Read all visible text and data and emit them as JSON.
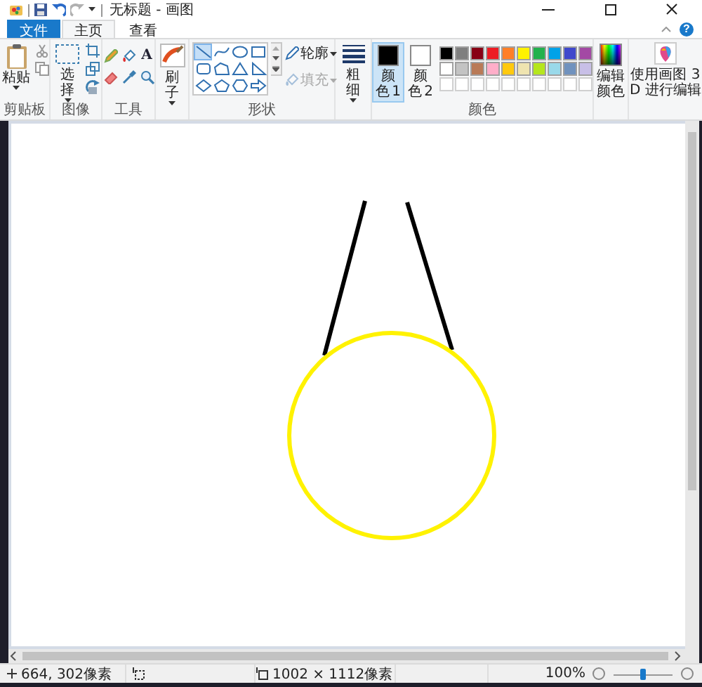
{
  "window": {
    "title": "无标题 - 画图"
  },
  "quick_access": [
    {
      "kind": "save",
      "disabled": false
    },
    {
      "kind": "undo",
      "disabled": false
    },
    {
      "kind": "redo",
      "disabled": true
    }
  ],
  "tabs": [
    {
      "label": "文件",
      "kind": "file",
      "selected": false
    },
    {
      "label": "主页",
      "kind": "tab",
      "selected": true
    },
    {
      "label": "查看",
      "kind": "tab",
      "selected": false
    }
  ],
  "help": "?",
  "ribbon": {
    "clipboard": {
      "label": "剪贴板",
      "paste": "粘贴"
    },
    "image": {
      "label": "图像",
      "select": "选择"
    },
    "tools": {
      "label": "工具",
      "text_tool": "A"
    },
    "brushes": "刷子",
    "shapes": {
      "label": "形状",
      "items": [
        {
          "kind": "line",
          "selected": true
        },
        {
          "kind": "curve",
          "selected": false
        },
        {
          "kind": "oval",
          "selected": false
        },
        {
          "kind": "rectangle",
          "selected": false
        },
        {
          "kind": "rounded",
          "selected": false
        },
        {
          "kind": "polygon",
          "selected": false
        },
        {
          "kind": "triangle",
          "selected": false
        },
        {
          "kind": "right-triangle",
          "selected": false
        },
        {
          "kind": "diamond",
          "selected": false
        },
        {
          "kind": "pentagon",
          "selected": false
        },
        {
          "kind": "hexagon",
          "selected": false
        },
        {
          "kind": "arrow",
          "selected": false
        }
      ],
      "outline": {
        "label": "轮廓",
        "disabled": false
      },
      "fill": {
        "label": "填充",
        "disabled": true
      }
    },
    "size": "粗细",
    "colors": {
      "label": "颜色",
      "current": [
        {
          "label": "颜色 1",
          "color": "#000000",
          "selected": true
        },
        {
          "label": "颜色 2",
          "color": "#ffffff",
          "selected": false
        }
      ],
      "palette": [
        {
          "color": "#000000"
        },
        {
          "color": "#7f7f7f"
        },
        {
          "color": "#880015"
        },
        {
          "color": "#ed1c24"
        },
        {
          "color": "#ff7f27"
        },
        {
          "color": "#fff200"
        },
        {
          "color": "#22b14c"
        },
        {
          "color": "#00a2e8"
        },
        {
          "color": "#3f48cc"
        },
        {
          "color": "#a349a4"
        },
        {
          "color": "#ffffff"
        },
        {
          "color": "#c3c3c3"
        },
        {
          "color": "#b97a57"
        },
        {
          "color": "#ffaec9"
        },
        {
          "color": "#ffc90e"
        },
        {
          "color": "#efe4b0"
        },
        {
          "color": "#b5e61d"
        },
        {
          "color": "#99d9ea"
        },
        {
          "color": "#7092be"
        },
        {
          "color": "#c8bfe7"
        }
      ],
      "edit_colors": "编辑颜色"
    },
    "paint3d": "使用画图 3D 进行编辑"
  },
  "status_bar": {
    "cursor_position": "664, 302像素",
    "image_size": "1002 × 1112像素",
    "zoom": "100%",
    "zoom_slider": {
      "level": 0.5
    }
  }
}
